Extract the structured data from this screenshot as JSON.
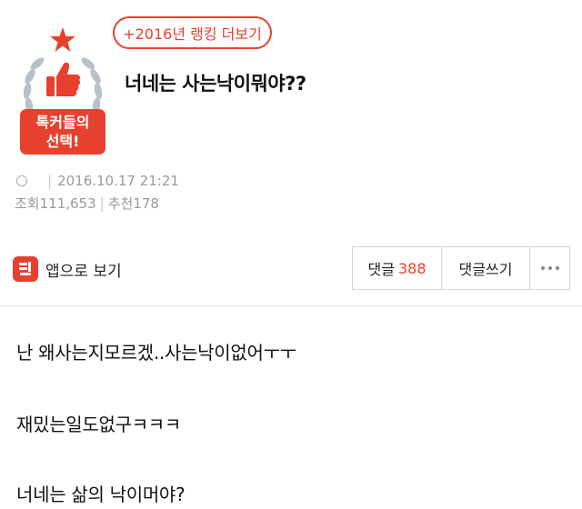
{
  "ranking_link": "+2016년 랭킹 더보기",
  "badge": {
    "line1": "톡커들의",
    "line2": "선택!"
  },
  "post": {
    "title": "너네는 사는낙이뭐야??",
    "date": "2016.10.17 21:21",
    "views_label": "조회",
    "views": "111,653",
    "recommend_label": "추천",
    "recommend": "178"
  },
  "app_view_label": "앱으로 보기",
  "actions": {
    "comments_label": "댓글",
    "comments_count": "388",
    "write_comment": "댓글쓰기"
  },
  "body_lines": [
    "난 왜사는지모르겠..사는낙이없어ㅜㅜ",
    "재밌는일도없구ㅋㅋㅋ",
    "너네는 삶의 낙이머야?"
  ],
  "colors": {
    "accent": "#e8402e",
    "wreath": "#b9c0cc"
  }
}
